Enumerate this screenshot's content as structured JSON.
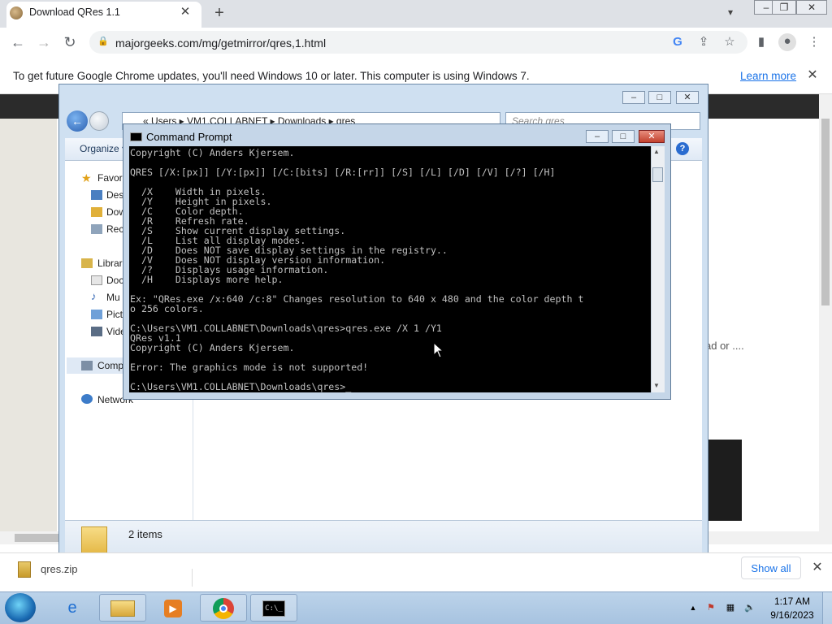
{
  "browser": {
    "tab_title": "Download QRes 1.1",
    "tab_close": "✕",
    "new_tab": "+",
    "url": "majorgeeks.com/mg/getmirror/qres,1.html",
    "window_min": "‒",
    "window_restore": "❐",
    "window_close": "✕"
  },
  "infobar": {
    "message": "To get future Google Chrome updates, you'll need Windows 10 or later. This computer is using Windows 7.",
    "learn_more": "Learn more",
    "close": "✕"
  },
  "page": {
    "partial_text": "ad or ....",
    "ad_close": "✕"
  },
  "download_shelf": {
    "file_name": "qres.zip",
    "show_all": "Show all",
    "close": "✕"
  },
  "explorer": {
    "address_path": "«  Users  ▸  VM1.COLLABNET  ▸  Downloads  ▸  qres",
    "search_placeholder": "Search qres",
    "organize": "Organize ▾",
    "nav": {
      "favorites": "Favor",
      "desktop": "Desk",
      "downloads": "Dow",
      "recent": "Rec",
      "libraries": "Librar",
      "documents": "Doc",
      "music": "Mu",
      "pictures": "Pict",
      "videos": "Vide",
      "computer": "Comp",
      "network": "Network"
    },
    "status_count": "2 items"
  },
  "cmd": {
    "title": "Command Prompt",
    "lines": [
      "Copyright (C) Anders Kjersem.",
      "",
      "QRES [/X:[px]] [/Y:[px]] [/C:[bits] [/R:[rr]] [/S] [/L] [/D] [/V] [/?] [/H]",
      "",
      "  /X    Width in pixels.",
      "  /Y    Height in pixels.",
      "  /C    Color depth.",
      "  /R    Refresh rate.",
      "  /S    Show current display settings.",
      "  /L    List all display modes.",
      "  /D    Does NOT save display settings in the registry..",
      "  /V    Does NOT display version information.",
      "  /?    Displays usage information.",
      "  /H    Displays more help.",
      "",
      "Ex: \"QRes.exe /x:640 /c:8\" Changes resolution to 640 x 480 and the color depth t",
      "o 256 colors.",
      "",
      "C:\\Users\\VM1.COLLABNET\\Downloads\\qres>qres.exe /X 1 /Y1",
      "QRes v1.1",
      "Copyright (C) Anders Kjersem.",
      "",
      "Error: The graphics mode is not supported!",
      "",
      "C:\\Users\\VM1.COLLABNET\\Downloads\\qres>_"
    ]
  },
  "taskbar": {
    "time": "1:17 AM",
    "date": "9/16/2023"
  }
}
